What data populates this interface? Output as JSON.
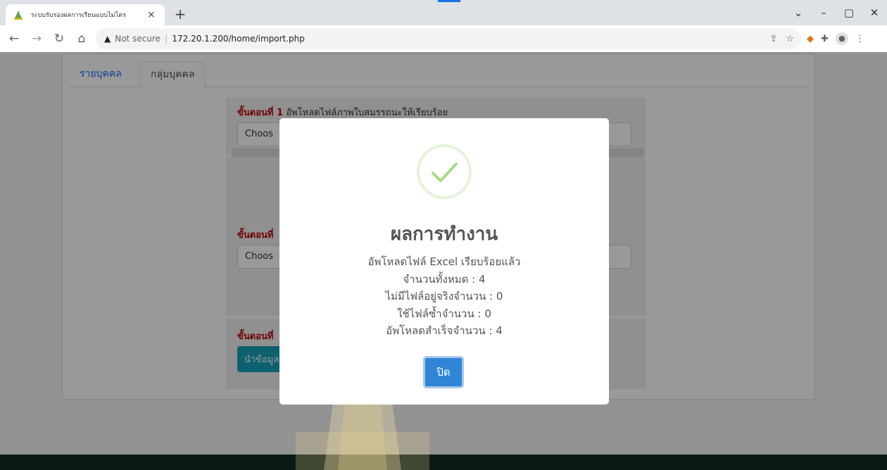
{
  "browser": {
    "tab_title": "ระบบรับรองผลการเรียนแบบไม่โดร",
    "tab_close": "×",
    "new_tab": "+",
    "not_secure": "Not secure",
    "url": "172.20.1.200/home/import.php",
    "win_controls": [
      "⌄",
      "–",
      "▢",
      "✕"
    ],
    "nav_icons": [
      "back-arrow-icon",
      "forward-arrow-icon",
      "reload-icon",
      "home-icon"
    ]
  },
  "page": {
    "tabs": [
      {
        "label": "รายบุคคล"
      },
      {
        "label": "กลุ่มบุคคล"
      }
    ],
    "step1": {
      "prefix": "ขั้นตอนที่ 1",
      "text": " อัพโหลดไฟล์ภาพใบสมรรถนะให้เรียบร้อย",
      "file_placeholder": "Choos"
    },
    "step2": {
      "prefix": "ขั้นตอนที่",
      "file_placeholder": "Choos"
    },
    "step3": {
      "prefix": "ขั้นตอนที่",
      "button_label": "นำข้อมูล"
    }
  },
  "modal": {
    "title": "ผลการทำงาน",
    "lines": [
      "อัพโหลดไฟล์ Excel เรียบร้อยแล้ว",
      "จำนวนทั้งหมด : 4",
      "ไม่มีไฟล์อยู่จริงจำนวน : 0",
      "ใช้ไฟล์ซ้ำจำนวน : 0",
      "อัพโหลดสำเร็จจำนวน : 4"
    ],
    "confirm_label": "ปิด",
    "success_color": "#a5dc86",
    "confirm_color": "#3085d6"
  },
  "colors": {
    "link": "#0d6efd",
    "step_prefix": "#c00000",
    "info_button": "#17a2b8",
    "footer": "#102a25"
  }
}
